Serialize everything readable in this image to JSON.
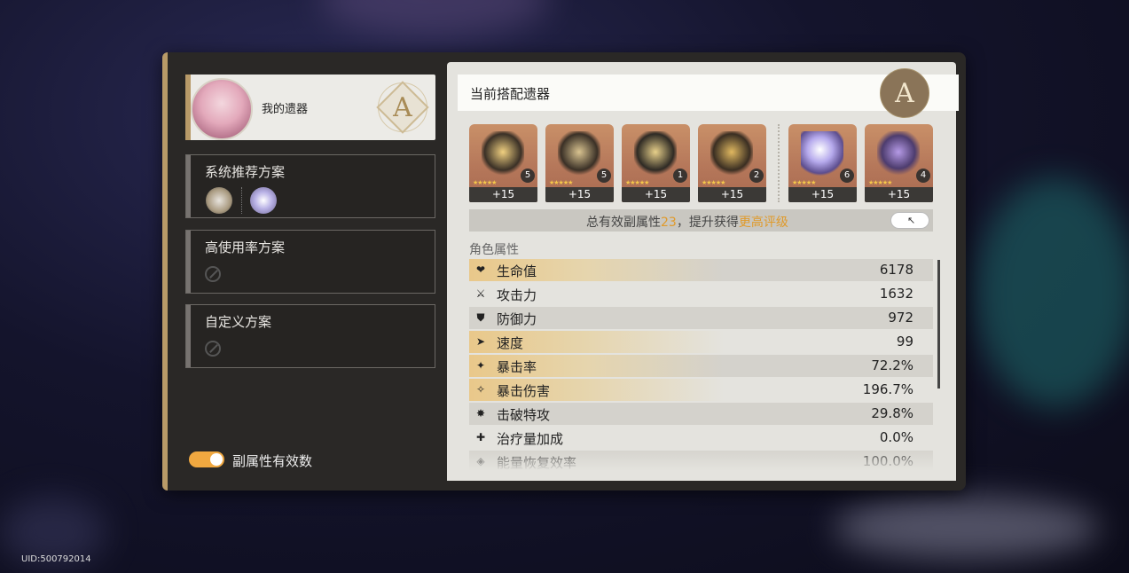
{
  "left": {
    "my_relics_title": "我的遗器",
    "rank": "A",
    "schemes": [
      {
        "title": "系统推荐方案",
        "empty": false
      },
      {
        "title": "高使用率方案",
        "empty": true
      },
      {
        "title": "自定义方案",
        "empty": true
      }
    ],
    "toggle_label": "副属性有效数",
    "toggle_on": true
  },
  "right": {
    "header_title": "当前搭配遗器",
    "rank": "A",
    "relics": [
      {
        "icon": "head-relic-icon",
        "level": "+15",
        "badge": "5"
      },
      {
        "icon": "hands-relic-icon",
        "level": "+15",
        "badge": "5"
      },
      {
        "icon": "body-relic-icon",
        "level": "+15",
        "badge": "1"
      },
      {
        "icon": "feet-relic-icon",
        "level": "+15",
        "badge": "2"
      },
      {
        "icon": "sphere-relic-icon",
        "level": "+15",
        "badge": "6"
      },
      {
        "icon": "rope-relic-icon",
        "level": "+15",
        "badge": "4"
      }
    ],
    "summary_prefix": "总有效副属性",
    "summary_count": "23",
    "summary_mid": "，提升获得",
    "summary_highlight": "更高评级",
    "attributes_label": "角色属性",
    "stats": [
      {
        "icon": "hp-icon",
        "name": "生命值",
        "value": "6178",
        "highlight": true
      },
      {
        "icon": "attack-icon",
        "name": "攻击力",
        "value": "1632",
        "highlight": false
      },
      {
        "icon": "defense-icon",
        "name": "防御力",
        "value": "972",
        "highlight": false
      },
      {
        "icon": "speed-icon",
        "name": "速度",
        "value": "99",
        "highlight": true
      },
      {
        "icon": "crit-rate-icon",
        "name": "暴击率",
        "value": "72.2%",
        "highlight": true
      },
      {
        "icon": "crit-dmg-icon",
        "name": "暴击伤害",
        "value": "196.7%",
        "highlight": true
      },
      {
        "icon": "break-effect-icon",
        "name": "击破特攻",
        "value": "29.8%",
        "highlight": false
      },
      {
        "icon": "healing-icon",
        "name": "治疗量加成",
        "value": "0.0%",
        "highlight": false
      },
      {
        "icon": "energy-regen-icon",
        "name": "能量恢复效率",
        "value": "100.0%",
        "highlight": false
      }
    ]
  },
  "uid": "UID:500792014",
  "colors": {
    "accent": "#f0a840",
    "gold": "#b89a68",
    "panel": "#2a2826"
  }
}
